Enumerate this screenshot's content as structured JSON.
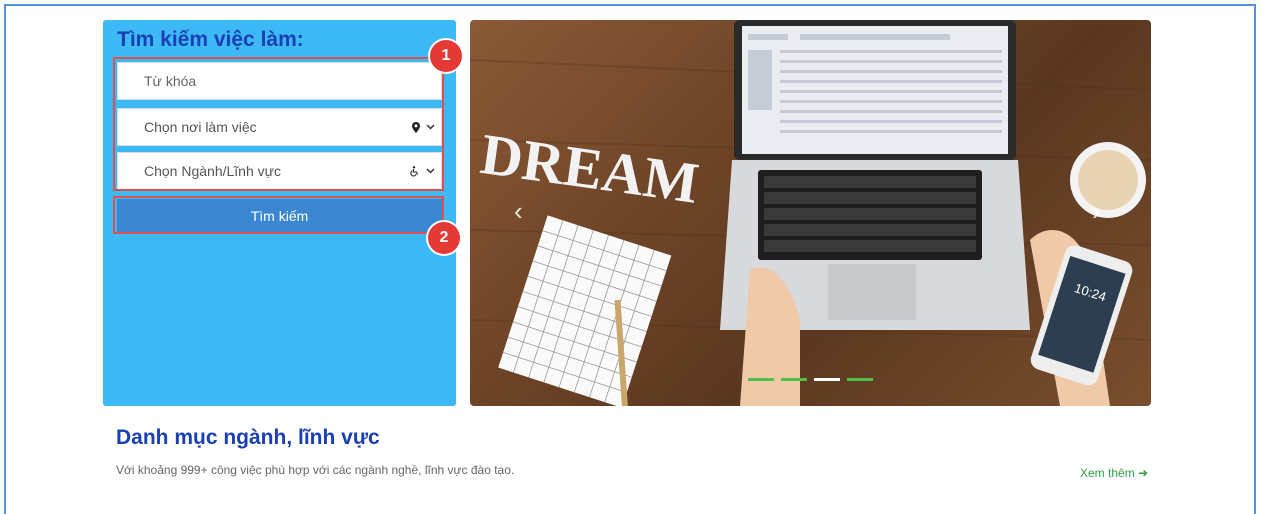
{
  "search": {
    "title": "Tìm kiếm việc làm:",
    "keyword_placeholder": "Từ khóa",
    "location_label": "Chọn nơi làm việc",
    "location_icon": "map-marker-icon",
    "field_label": "Chọn Ngành/Lĩnh vực",
    "field_icon": "wheelchair-icon",
    "button_label": "Tìm kiếm"
  },
  "annotations": [
    {
      "number": "1",
      "color": "#e53935"
    },
    {
      "number": "2",
      "color": "#e53935"
    }
  ],
  "hero": {
    "photo_text": "DREAM",
    "phone_time": "10:24",
    "slides_count": 4,
    "active_slide": 3
  },
  "category": {
    "title": "Danh mục ngành, lĩnh vực",
    "description": "Với khoảng 999+ công việc phù hợp với các ngành nghề, lĩnh vực đào tạo.",
    "more_label": "Xem thêm"
  },
  "colors": {
    "panel": "#3db9f5",
    "title": "#1b3fb4",
    "button": "#3a86d0",
    "link": "#2e9e48",
    "annotation": "#e53935"
  }
}
